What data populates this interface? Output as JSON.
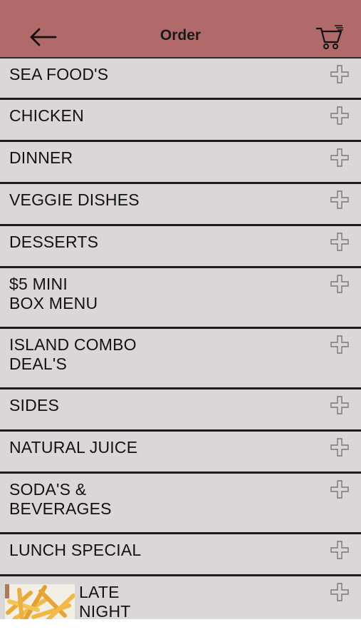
{
  "header": {
    "title": "Order",
    "back_icon": "arrow-left-icon",
    "cart_icon": "shopping-cart-icon",
    "bg_color": "#b06a6a"
  },
  "menu": {
    "items": [
      {
        "label": "SEA FOOD'S"
      },
      {
        "label": "CHICKEN"
      },
      {
        "label": "DINNER"
      },
      {
        "label": "VEGGIE DISHES"
      },
      {
        "label": "DESSERTS"
      },
      {
        "label": "$5 MINI\nBOX MENU"
      },
      {
        "label": "ISLAND COMBO\nDEAL'S"
      },
      {
        "label": "SIDES"
      },
      {
        "label": "NATURAL JUICE"
      },
      {
        "label": "SODA'S &\nBEVERAGES"
      },
      {
        "label": "LUNCH SPECIAL"
      },
      {
        "label": "LATE\nNIGHT"
      }
    ],
    "row_bg": "#dcd7d7",
    "expand_icon": "plus-icon"
  }
}
